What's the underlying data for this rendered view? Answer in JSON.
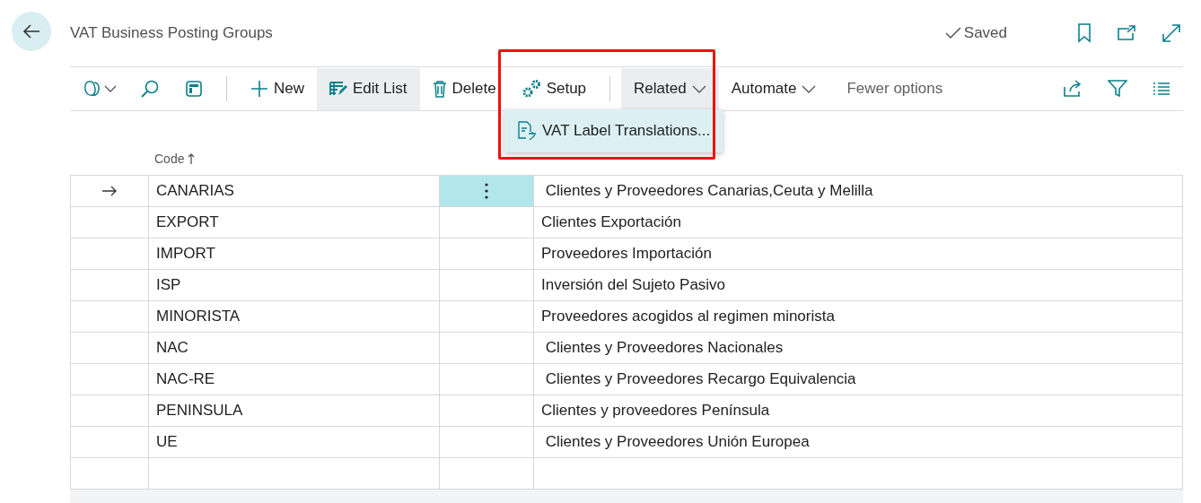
{
  "page": {
    "title": "VAT Business Posting Groups",
    "status": "Saved"
  },
  "toolbar": {
    "actions": [
      {
        "label": "New",
        "pressed": false
      },
      {
        "label": "Edit List",
        "pressed": true
      },
      {
        "label": "Delete",
        "pressed": false
      },
      {
        "label": "Setup",
        "pressed": false
      }
    ],
    "menus": [
      {
        "label": "Related",
        "expanded": true
      },
      {
        "label": "Automate",
        "expanded": false
      }
    ],
    "fewer_options": "Fewer options"
  },
  "dropdown": {
    "items": [
      {
        "label": "VAT Label Translations..."
      }
    ]
  },
  "table": {
    "columns": [
      "Code"
    ],
    "rows": [
      {
        "code": "CANARIAS",
        "description": " Clientes y Proveedores Canarias,Ceuta y Melilla",
        "selected": true
      },
      {
        "code": "EXPORT",
        "description": "Clientes Exportación",
        "selected": false
      },
      {
        "code": "IMPORT",
        "description": "Proveedores Importación",
        "selected": false
      },
      {
        "code": "ISP",
        "description": "Inversión del Sujeto Pasivo",
        "selected": false
      },
      {
        "code": "MINORISTA",
        "description": "Proveedores acogidos al regimen minorista",
        "selected": false
      },
      {
        "code": "NAC",
        "description": " Clientes y Proveedores Nacionales",
        "selected": false
      },
      {
        "code": "NAC-RE",
        "description": " Clientes y Proveedores Recargo Equivalencia",
        "selected": false
      },
      {
        "code": "PENINSULA",
        "description": "Clientes y proveedores Península",
        "selected": false
      },
      {
        "code": "UE",
        "description": " Clientes y Proveedores Unión Europea",
        "selected": false
      }
    ]
  }
}
